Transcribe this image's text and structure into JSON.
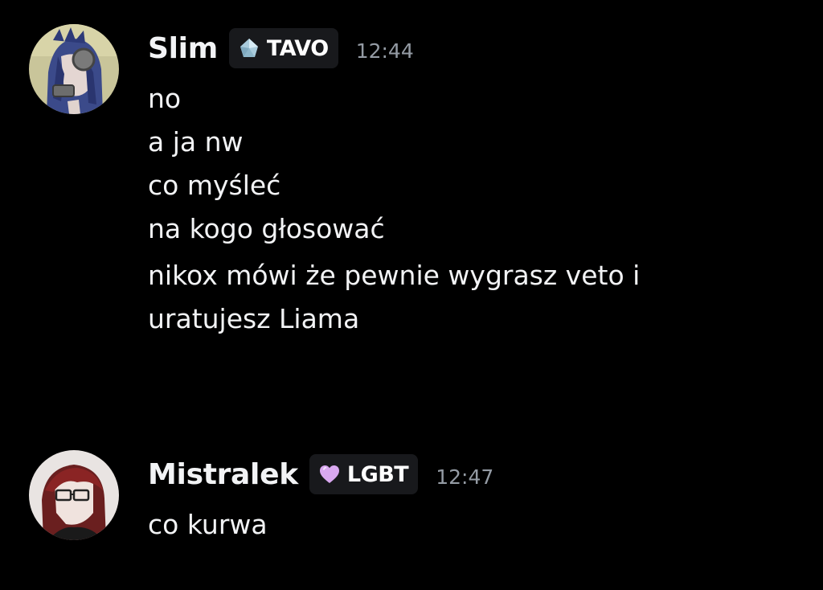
{
  "messages": [
    {
      "author": "Slim",
      "tag": {
        "label": "TAVO",
        "icon": "diamond-icon",
        "color": "#9fc3d6"
      },
      "timestamp": "12:44",
      "lines": [
        "no",
        "a ja nw",
        "co myśleć",
        "na kogo głosować",
        "nikox mówi że pewnie wygrasz veto i uratujesz Liama"
      ]
    },
    {
      "author": "Mistralek",
      "tag": {
        "label": "LGBT",
        "icon": "heart-icon",
        "color": "#d9a8f0"
      },
      "timestamp": "12:47",
      "lines": [
        "co kurwa"
      ]
    }
  ],
  "colors": {
    "background": "#000000",
    "text": "#f2f3f5",
    "timestamp": "#949ba4",
    "tag_background": "#18191c"
  }
}
